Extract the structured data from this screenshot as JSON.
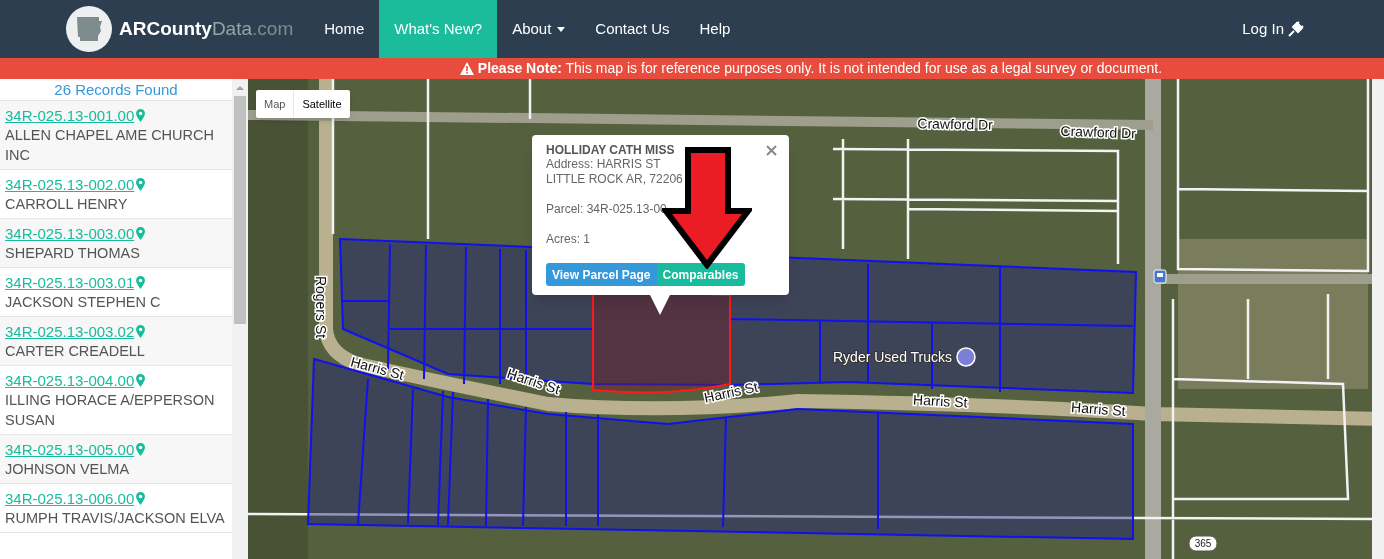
{
  "navbar": {
    "logo": {
      "name": "ARCounty",
      "accent": "Data",
      "suffix": ".com"
    },
    "items": [
      {
        "label": "Home",
        "selected": false,
        "dropdown": false
      },
      {
        "label": "What's New?",
        "selected": true,
        "dropdown": false
      },
      {
        "label": "About",
        "selected": false,
        "dropdown": true
      },
      {
        "label": "Contact Us",
        "selected": false,
        "dropdown": false
      },
      {
        "label": "Help",
        "selected": false,
        "dropdown": false
      }
    ],
    "login": "Log In"
  },
  "notice": "**Please Note:** This map is for reference purposes only. It is not intended for use as a legal survey or document.",
  "sidebar": {
    "heading": "26 Records Found",
    "records": [
      {
        "parcel": "34R-025.13-001.00",
        "owner": "ALLEN CHAPEL AME CHURCH INC"
      },
      {
        "parcel": "34R-025.13-002.00",
        "owner": "CARROLL HENRY"
      },
      {
        "parcel": "34R-025.13-003.00",
        "owner": "SHEPARD THOMAS"
      },
      {
        "parcel": "34R-025.13-003.01",
        "owner": "JACKSON STEPHEN C"
      },
      {
        "parcel": "34R-025.13-003.02",
        "owner": "CARTER CREADELL"
      },
      {
        "parcel": "34R-025.13-004.00",
        "owner": "ILLING HORACE A/EPPERSON SUSAN"
      },
      {
        "parcel": "34R-025.13-005.00",
        "owner": "JOHNSON VELMA"
      },
      {
        "parcel": "34R-025.13-006.00",
        "owner": "RUMPH TRAVIS/JACKSON ELVA"
      }
    ]
  },
  "map": {
    "type_buttons": [
      {
        "label": "Map",
        "selected": false
      },
      {
        "label": "Satellite",
        "selected": true
      }
    ],
    "labels": [
      {
        "text": "Crawford Dr",
        "kind": "street"
      },
      {
        "text": "Crawford Dr",
        "kind": "street"
      },
      {
        "text": "Rogers St",
        "kind": "street"
      },
      {
        "text": "Harris St",
        "kind": "street"
      },
      {
        "text": "Harris St",
        "kind": "street"
      },
      {
        "text": "Harris St",
        "kind": "street"
      },
      {
        "text": "Harris St",
        "kind": "street"
      },
      {
        "text": "Harris St",
        "kind": "street"
      },
      {
        "text": "Ryder Used Trucks",
        "kind": "place"
      },
      {
        "text": "365",
        "kind": "shield"
      }
    ],
    "popup": {
      "title": "HOLLIDAY CATH MISS",
      "address": "Address: HARRIS ST",
      "city": "LITTLE ROCK AR, 72206",
      "parcel": "Parcel: 34R-025.13-00",
      "acres": "Acres: 1",
      "buttons": [
        {
          "label": "View Parcel Page",
          "kind": "primary"
        },
        {
          "label": "Comparables",
          "kind": "success"
        }
      ]
    }
  }
}
